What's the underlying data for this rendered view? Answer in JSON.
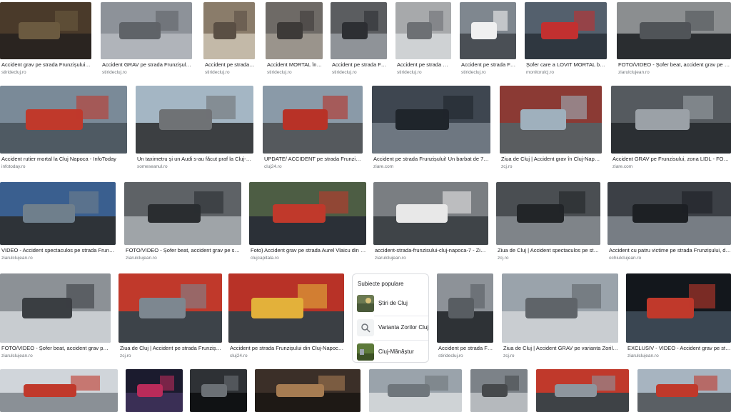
{
  "images": [
    {
      "caption": "Accident grav pe strada Frunzișului din ...",
      "source": "stiridecluj.ro",
      "palette": [
        "#4a3a2a",
        "#6b5a40",
        "#2a2420"
      ]
    },
    {
      "caption": "Accident GRAV pe strada Frunzișului. Tr...",
      "source": "stiridecluj.ro",
      "palette": [
        "#8d9299",
        "#5f6368",
        "#b0b4ba"
      ]
    },
    {
      "caption": "Accident pe strada Fru...",
      "source": "stiridecluj.ro",
      "palette": [
        "#8a7c6a",
        "#5a4f44",
        "#c3b9a8"
      ]
    },
    {
      "caption": "Accident MORTAL în Cl...",
      "source": "stiridecluj.ro",
      "palette": [
        "#6e6a66",
        "#3d3a38",
        "#9a948c"
      ]
    },
    {
      "caption": "Accident pe strada Fru...",
      "source": "stiridecluj.ro",
      "palette": [
        "#5b5d60",
        "#2d2f33",
        "#8f9398"
      ]
    },
    {
      "caption": "Accident pe strada Fru...",
      "source": "stiridecluj.ro",
      "palette": [
        "#a7a9ab",
        "#6d7074",
        "#cfd2d4"
      ]
    },
    {
      "caption": "Accident pe strada Fru...",
      "source": "stiridecluj.ro",
      "palette": [
        "#7f878f",
        "#f0f0f0",
        "#4a4f55"
      ]
    },
    {
      "caption": "Șofer care a LOVIT MORTAL bătrâ...",
      "source": "monitorulcj.ro",
      "palette": [
        "#54606d",
        "#c23030",
        "#2f3740"
      ]
    },
    {
      "caption": "FOTO/VIDEO - Șofer beat, accident grav pe strada ...",
      "source": "ziarulclujean.ro",
      "palette": [
        "#8b8e90",
        "#505458",
        "#2a2d30"
      ]
    },
    {
      "caption": "Accident rutier mortal la Cluj Napoca - InfoToday",
      "source": "infotoday.ro",
      "palette": [
        "#7a8a98",
        "#c0392b",
        "#4f5a63"
      ]
    },
    {
      "caption": "Un taximetru și un Audi s-au făcut praf la Cluj-Napo...",
      "source": "someseanul.ro",
      "palette": [
        "#a4b6c4",
        "#6f7275",
        "#3c3f42"
      ]
    },
    {
      "caption": "UPDATE/ ACCIDENT pe strada Frunzișului d...",
      "source": "cluj24.ro",
      "palette": [
        "#8a9aa8",
        "#b83227",
        "#55595d"
      ]
    },
    {
      "caption": "Accident pe strada Frunzișului! Un barbat de 73 de a...",
      "source": "ziare.com",
      "palette": [
        "#3e4650",
        "#1f252b",
        "#6e7781"
      ]
    },
    {
      "caption": "Ziua de Cluj | Accident grav în Cluj-Napoca / ...",
      "source": "zcj.ro",
      "palette": [
        "#8b3a34",
        "#9fb0bd",
        "#5a5d60"
      ]
    },
    {
      "caption": "Accident GRAV pe Frunzisului, zona LIDL - FOTO | Clu...",
      "source": "ziare.com",
      "palette": [
        "#555a5f",
        "#9ba1a7",
        "#2b2f33"
      ]
    },
    {
      "caption": "VIDEO - Accident spectaculos pe strada Frunzișul...",
      "source": "ziarulclujean.ro",
      "palette": [
        "#3a5f8f",
        "#6f7f8c",
        "#2e3338"
      ]
    },
    {
      "caption": "FOTO/VIDEO - Șofer beat, accident grav pe strada ...",
      "source": "ziarulclujean.ro",
      "palette": [
        "#5e6266",
        "#2a2d30",
        "#9fa4a8"
      ]
    },
    {
      "caption": "Foto) Accident grav pe strada Aurel Vlaicu din Cluj ...",
      "source": "clujcapitala.ro",
      "palette": [
        "#4d5d44",
        "#c0392b",
        "#2b3037"
      ]
    },
    {
      "caption": "accident-strada-frunzisului-cluj-napoca-7 - Ziarul ...",
      "source": "ziarulclujean.ro",
      "palette": [
        "#7a7e82",
        "#e8e8e8",
        "#3f4448"
      ]
    },
    {
      "caption": "Ziua de Cluj | Accident spectaculos pe strada ...",
      "source": "zcj.ro",
      "palette": [
        "#4a4e52",
        "#222528",
        "#7f8489"
      ]
    },
    {
      "caption": "Accident cu patru victime pe strada Frunzișului, după ...",
      "source": "ochiulclujean.ro",
      "palette": [
        "#3c4046",
        "#1d2024",
        "#777d84"
      ]
    },
    {
      "caption": "FOTO/VIDEO - Șofer beat, accident grav pe strada ...",
      "source": "ziarulclujean.ro",
      "palette": [
        "#8c9196",
        "#3a3e42",
        "#c8ccd0"
      ]
    },
    {
      "caption": "Ziua de Cluj | Accident pe strada Frunzișului. O maș...",
      "source": "zcj.ro",
      "palette": [
        "#c0392b",
        "#7d8790",
        "#3d4349"
      ]
    },
    {
      "caption": "Accident pe strada Frunzișului din Cluj-Napoca. Tr...",
      "source": "cluj24.ro",
      "palette": [
        "#b83227",
        "#e3b13a",
        "#3b3f44"
      ]
    },
    {
      "caption": "Accident pe strada Fru...",
      "source": "stiridecluj.ro",
      "palette": [
        "#8d9298",
        "#585d62",
        "#2e3236"
      ]
    },
    {
      "caption": "Ziua de Cluj | Accident GRAV pe varianta Zorilor - M...",
      "source": "zcj.ro",
      "palette": [
        "#9aa3ab",
        "#5f6469",
        "#c9cdd1"
      ]
    },
    {
      "caption": "EXCLUSIV - VIDEO - Accident grav pe strada Frunzișul...",
      "source": "ziarulclujean.ro",
      "palette": [
        "#13171c",
        "#c0392b",
        "#3a4652"
      ]
    },
    {
      "caption": "",
      "source": "",
      "palette": [
        "#d0d5da",
        "#c0392b",
        "#8a9096"
      ]
    },
    {
      "caption": "",
      "source": "",
      "palette": [
        "#1b1b2e",
        "#b92b5a",
        "#3a2f55"
      ]
    },
    {
      "caption": "",
      "source": "",
      "palette": [
        "#2e3135",
        "#6b7075",
        "#101214"
      ]
    },
    {
      "caption": "",
      "source": "",
      "palette": [
        "#3b2f28",
        "#a67c52",
        "#1e1915"
      ]
    },
    {
      "caption": "",
      "source": "",
      "palette": [
        "#9aa3ab",
        "#6f767c",
        "#cfd3d6"
      ]
    },
    {
      "caption": "",
      "source": "",
      "palette": [
        "#7c8288",
        "#46494c",
        "#b5b9bd"
      ]
    },
    {
      "caption": "",
      "source": "",
      "palette": [
        "#c0392b",
        "#8e969e",
        "#3e4246"
      ]
    },
    {
      "caption": "",
      "source": "",
      "palette": [
        "#a7b4c0",
        "#c0392b",
        "#5a5f64"
      ]
    }
  ],
  "popular_topics": {
    "title": "Subiecte populare",
    "items": [
      {
        "label": "Știri de Cluj",
        "icon": "news-thumbnail"
      },
      {
        "label": "Varianta Zorilor Cluj",
        "icon": "search-icon"
      },
      {
        "label": "Cluj-Mănăștur",
        "icon": "place-thumbnail"
      }
    ]
  }
}
